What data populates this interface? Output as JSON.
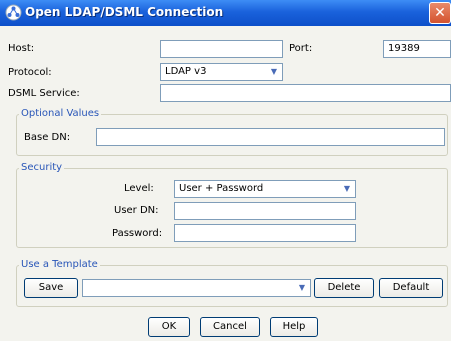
{
  "window": {
    "title": "Open LDAP/DSML Connection",
    "close_symbol": "✕"
  },
  "connection": {
    "host_label": "Host:",
    "host_value": "",
    "port_label": "Port:",
    "port_value": "19389",
    "protocol_label": "Protocol:",
    "protocol_value": "LDAP v3",
    "dsml_label": "DSML Service:",
    "dsml_value": ""
  },
  "optional_values": {
    "group_title": "Optional Values",
    "base_dn_label": "Base DN:",
    "base_dn_value": ""
  },
  "security": {
    "group_title": "Security",
    "level_label": "Level:",
    "level_value": "User + Password",
    "user_dn_label": "User DN:",
    "user_dn_value": "",
    "password_label": "Password:",
    "password_value": ""
  },
  "template": {
    "group_title": "Use a Template",
    "save_label": "Save",
    "selected_value": "",
    "delete_label": "Delete",
    "default_label": "Default"
  },
  "footer": {
    "ok_label": "OK",
    "cancel_label": "Cancel",
    "help_label": "Help"
  },
  "icons": {
    "title_icon": "ldap-connection-icon",
    "close": "close-icon",
    "dropdown": "chevron-down-icon"
  },
  "colors": {
    "titlebar": "#1a62dc",
    "group_title": "#2956b8",
    "close_button": "#d4532f",
    "window_bg": "#f3f3ee"
  }
}
